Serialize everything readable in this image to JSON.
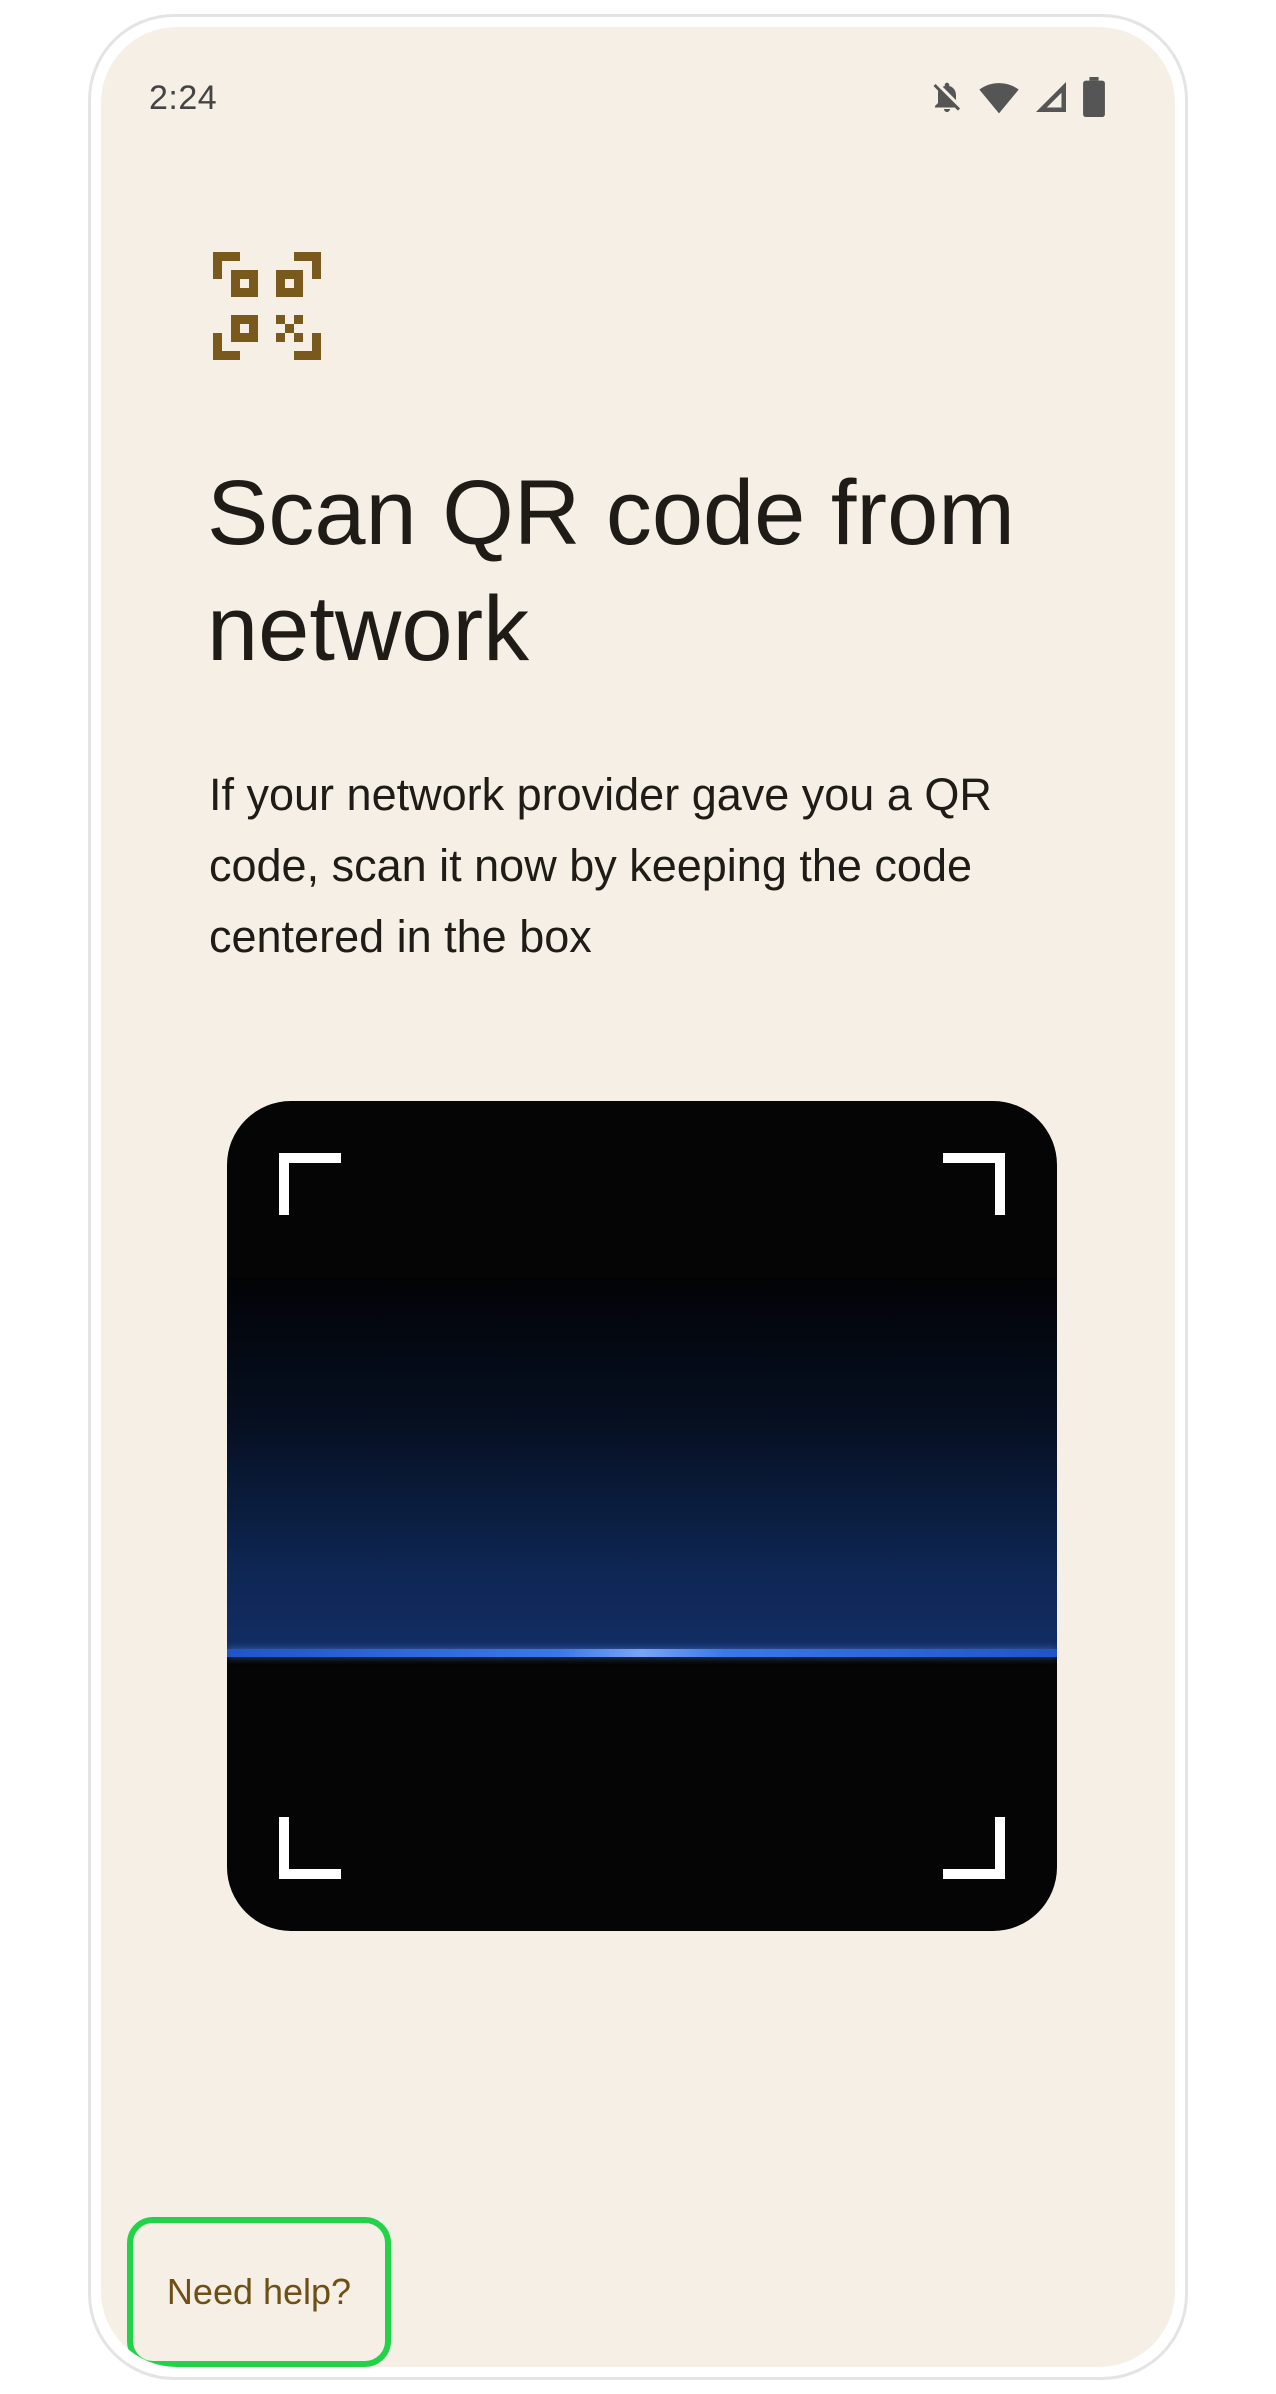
{
  "status_bar": {
    "time": "2:24",
    "icons": [
      "notifications-off-icon",
      "wifi-icon",
      "cell-signal-icon",
      "battery-icon"
    ]
  },
  "header": {
    "icon": "qr-code-icon",
    "title": "Scan QR code from network"
  },
  "body": {
    "description": "If your network provider gave you a QR code, scan it now by keeping the code centered in the box"
  },
  "scanner": {
    "state": "scanning"
  },
  "footer": {
    "help_label": "Need help?"
  },
  "colors": {
    "background": "#f5efe5",
    "accent": "#7a5a1c",
    "text": "#1f1b16",
    "scan_line": "#3a78e8",
    "help_outline": "#22d34a"
  }
}
